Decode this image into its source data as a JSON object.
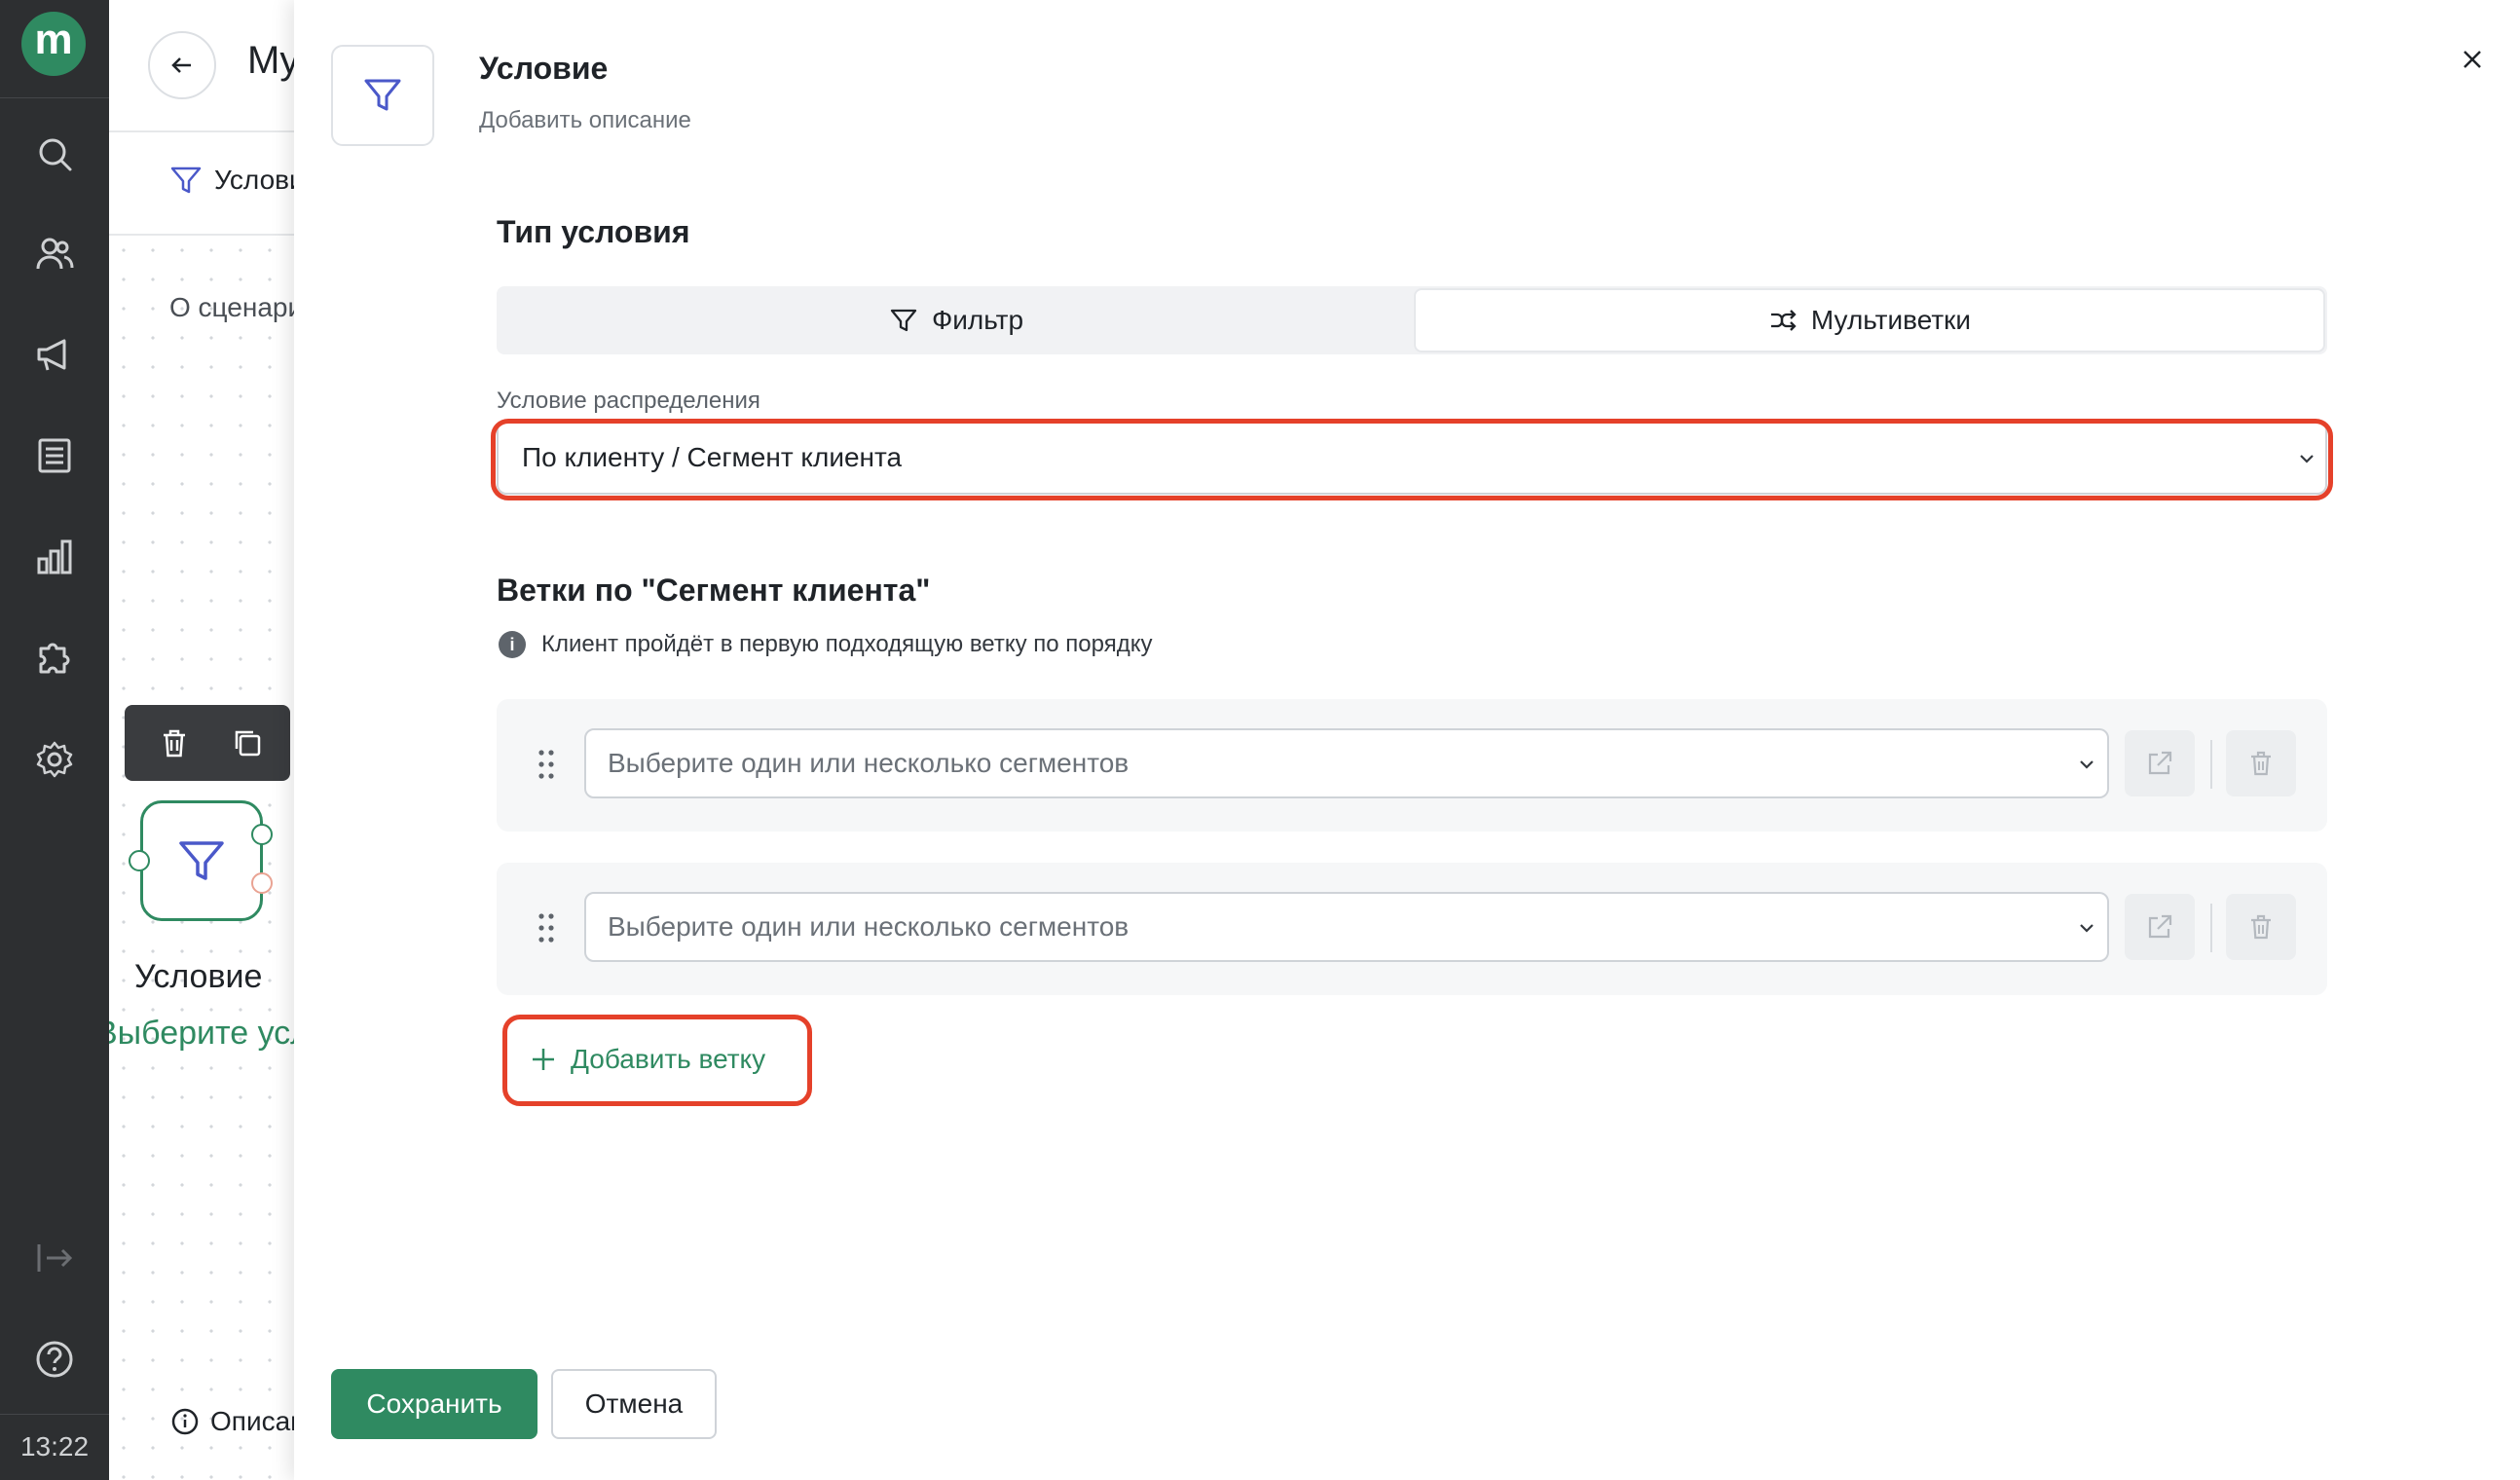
{
  "nav": {
    "logo_letter": "m",
    "time": "13:22",
    "icons": [
      "search-icon",
      "users-icon",
      "megaphone-icon",
      "list-icon",
      "bar-chart-icon",
      "puzzle-icon",
      "gear-icon",
      "collapse-icon",
      "help-icon"
    ]
  },
  "background": {
    "title": "My",
    "tab_label": "Условие",
    "about_label": "О сценарии",
    "node_label": "Условие",
    "node_sub": "Выберите условие",
    "bottom_label": "Описание"
  },
  "panel": {
    "title": "Условие",
    "description": "Добавить описание",
    "condition_type_title": "Тип условия",
    "options": {
      "filter": "Фильтр",
      "multibranch": "Мультиветки"
    },
    "distribution_label": "Условие распределения",
    "distribution_value": "По клиенту / Сегмент клиента",
    "branches_title": "Ветки по \"Сегмент клиента\"",
    "branches_info": "Клиент пройдёт в первую подходящую ветку по порядку",
    "branches": [
      {
        "placeholder": "Выберите один или несколько сегментов"
      },
      {
        "placeholder": "Выберите один или несколько сегментов"
      }
    ],
    "add_branch": "Добавить ветку",
    "save": "Сохранить",
    "cancel": "Отмена"
  },
  "colors": {
    "accent": "#2f8a61",
    "highlight": "#e5412a",
    "nav_bg": "#2d2f31"
  }
}
